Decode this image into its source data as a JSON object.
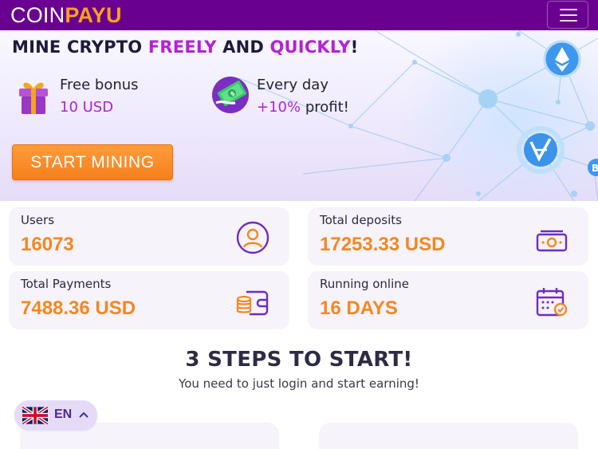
{
  "header": {
    "logo_part1": "COIN",
    "logo_part2": "PAYU",
    "menu_icon": "hamburger-icon"
  },
  "hero": {
    "title": {
      "part1": "MINE CRYPTO ",
      "highlight1": "FREELY",
      "part2": " AND ",
      "highlight2": "QUICKLY",
      "part3": "!"
    },
    "features": [
      {
        "icon": "gift-icon",
        "label": "Free bonus",
        "value": "10 USD"
      },
      {
        "icon": "money-icon",
        "label": "Every day",
        "value_highlight": "+10%",
        "value_rest": " profit!"
      }
    ],
    "cta_label": "START MINING",
    "decor_icons": [
      "ethereum-icon",
      "vechain-icon",
      "bitcoin-icon"
    ]
  },
  "stats": [
    {
      "label": "Users",
      "value": "16073",
      "icon": "user-icon"
    },
    {
      "label": "Total deposits",
      "value": "17253.33 USD",
      "icon": "cash-icon"
    },
    {
      "label": "Total Payments",
      "value": "7488.36 USD",
      "icon": "wallet-icon"
    },
    {
      "label": "Running online",
      "value": "16 DAYS",
      "icon": "calendar-check-icon"
    }
  ],
  "steps": {
    "title": "3 STEPS TO START!",
    "subtitle": "You need to just login and start earning!"
  },
  "language": {
    "code": "EN",
    "flag": "uk-flag-icon",
    "chevron": "chevron-up-icon"
  },
  "colors": {
    "brand_purple": "#6a008f",
    "highlight": "#b421d6",
    "accent_orange": "#f5871f"
  }
}
